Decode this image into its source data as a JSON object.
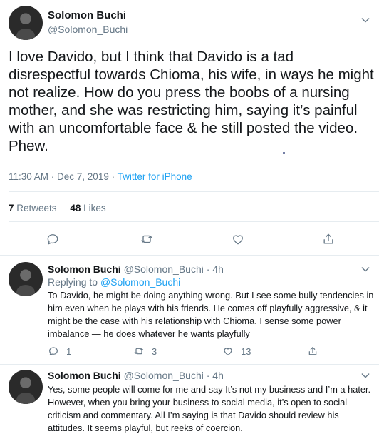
{
  "main_tweet": {
    "author_name": "Solomon Buchi",
    "author_handle": "@Solomon_Buchi",
    "text": "I love Davido, but I think that Davido is a tad disrespectful towards Chioma, his wife, in ways he might not realize. How do you press the boobs of a nursing mother, and she was restricting him, saying it’s painful with an uncomfortable face & he still posted the video. Phew.",
    "time": "11:30 AM · Dec 7, 2019 · ",
    "source": "Twitter for iPhone",
    "retweets_count": "7",
    "retweets_label": "Retweets",
    "likes_count": "48",
    "likes_label": "Likes"
  },
  "replies": [
    {
      "author_name": "Solomon Buchi",
      "author_handle": "@Solomon_Buchi · 4h",
      "replying_prefix": "Replying to ",
      "replying_handle": "@Solomon_Buchi",
      "text": "To Davido, he might be doing anything wrong. But I see some bully tendencies in him even when he plays with his friends. He comes off playfully aggressive, & it might be the case with his relationship with Chioma. I sense some power imbalance — he does whatever he wants playfully",
      "reply_count": "1",
      "retweet_count": "3",
      "like_count": "13"
    },
    {
      "author_name": "Solomon Buchi",
      "author_handle": "@Solomon_Buchi · 4h",
      "text": "Yes, some people will come for me and say It’s not my business and I’m a hater. However, when you bring your business to social media, it’s open to social criticism and commentary. All I’m saying is that Davido should review his attitudes. It seems playful, but reeks of coercion."
    }
  ],
  "colors": {
    "text": "#14171a",
    "secondary": "#657786",
    "link": "#1da1f2",
    "divider": "#e6ecf0"
  },
  "icons": [
    "chevron-down-icon",
    "reply-icon",
    "retweet-icon",
    "like-icon",
    "share-icon"
  ]
}
